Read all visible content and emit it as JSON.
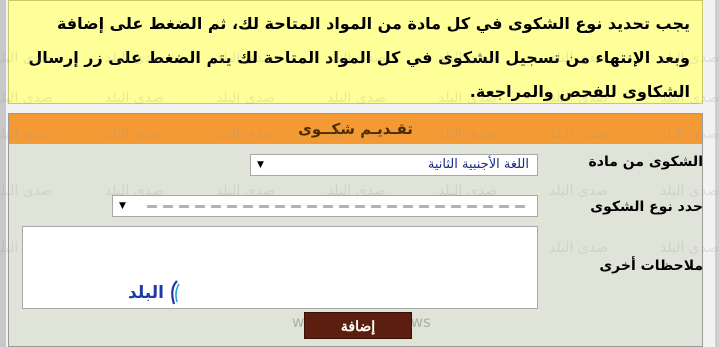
{
  "notice": {
    "text": "يجب تحديد نوع الشكوى في كل مادة من المواد المتاحة لك، ثم الضغط على إضافة وبعد الإنتهاء من تسجيل الشكوى في كل المواد المتاحة لك يتم الضغط على زر إرسال الشكاوى للفحص والمراجعة."
  },
  "form": {
    "title": "تقـديـم شكــوى",
    "subject_label": "الشكوى من مادة",
    "subject_value": "اللغة الأجنبية الثانية",
    "type_label": "حدد نوع الشكوى",
    "notes_label": "ملاحظات أخرى",
    "submit_label": "إضافة"
  },
  "watermark": {
    "text": "صدى البلد",
    "site": "www.elbalad.news"
  },
  "logo": {
    "text": "البلد"
  },
  "icons": {
    "select_arrow": "dropdown-arrow-icon"
  }
}
